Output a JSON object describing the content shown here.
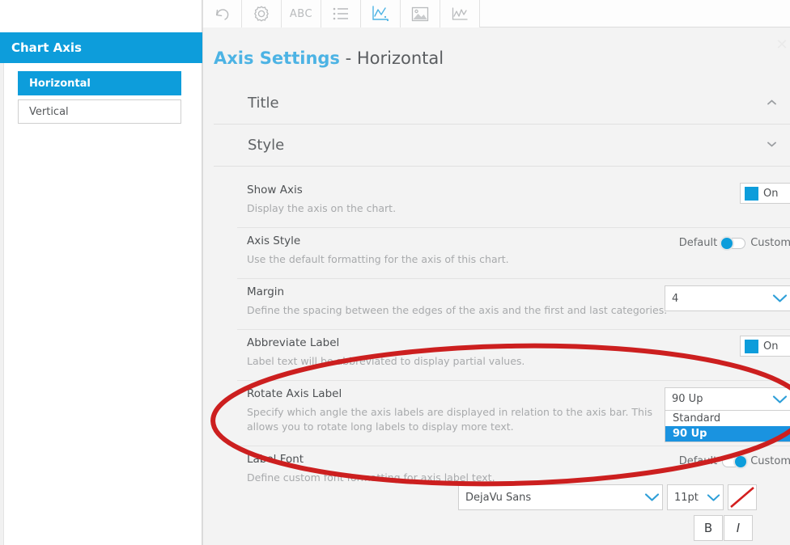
{
  "toolbar": {
    "buttons": [
      {
        "name": "undo-icon",
        "label": "Undo",
        "icon": "undo-icon",
        "active": false
      },
      {
        "name": "settings-icon",
        "label": "Settings",
        "icon": "gear-icon",
        "active": false
      },
      {
        "name": "text-icon",
        "label": "ABC",
        "icon": "abc-icon",
        "active": false
      },
      {
        "name": "list-icon",
        "label": "List",
        "icon": "list-icon",
        "active": false
      },
      {
        "name": "chart-icon",
        "label": "Chart",
        "icon": "line-chart-axis-icon",
        "active": true
      },
      {
        "name": "image-icon",
        "label": "Image",
        "icon": "picture-icon",
        "active": false
      },
      {
        "name": "sparkline-icon",
        "label": "Sparkline",
        "icon": "trend-chart-icon",
        "active": false
      }
    ]
  },
  "sidebar": {
    "header": "Chart Axis",
    "items": [
      {
        "label": "Horizontal",
        "active": true
      },
      {
        "label": "Vertical",
        "active": false
      }
    ]
  },
  "main": {
    "title_accent": "Axis Settings",
    "title_rest": " - Horizontal",
    "close_label": "✕",
    "sections": [
      {
        "label": "Title",
        "chevron": "chevron-up-icon"
      },
      {
        "label": "Style",
        "chevron": "chevron-down-icon"
      }
    ],
    "rows": [
      {
        "title": "Show Axis",
        "desc": "Display the axis on the chart.",
        "control": "toggle-on",
        "on_label": "On"
      },
      {
        "title": "Axis Style",
        "desc": "Use the default formatting for the axis of this chart.",
        "control": "default-custom",
        "left_label": "Default",
        "right_label": "Custom",
        "position": "left"
      },
      {
        "title": "Margin",
        "desc": "Define the spacing between the edges of the axis and the first and last categories.",
        "control": "select",
        "value": "4"
      },
      {
        "title": "Abbreviate Label",
        "desc": "Label text will be abbreviated to display partial values.",
        "control": "toggle-on",
        "on_label": "On"
      },
      {
        "title": "Rotate Axis Label",
        "desc": "Specify which angle the axis labels are displayed in relation to the axis bar. This allows you to rotate long labels to display more text.",
        "control": "select-open",
        "value": "90 Up",
        "options": [
          {
            "label": "Standard",
            "selected": false
          },
          {
            "label": "90 Up",
            "selected": true
          }
        ]
      },
      {
        "title": "Label Font",
        "desc": "Define custom font formatting for axis label text.",
        "control": "font",
        "left_label": "Default",
        "right_label": "Custom",
        "position": "right",
        "font_family": "DejaVu Sans",
        "font_size": "11pt",
        "color_swatch": "none-color-icon",
        "bold_label": "B",
        "italic_label": "I"
      }
    ]
  },
  "colors": {
    "accent_blue": "#0d9ddb",
    "title_blue": "#4cb3e4",
    "highlight_blue": "#1a93e0",
    "annotation_red": "#cc1f1f",
    "panel_bg": "#f3f3f3",
    "text_dark": "#4e5154",
    "text_muted": "#a8aaac"
  },
  "annotation": {
    "shape": "ellipse",
    "color": "#cc1f1f",
    "target": "Rotate Axis Label"
  }
}
